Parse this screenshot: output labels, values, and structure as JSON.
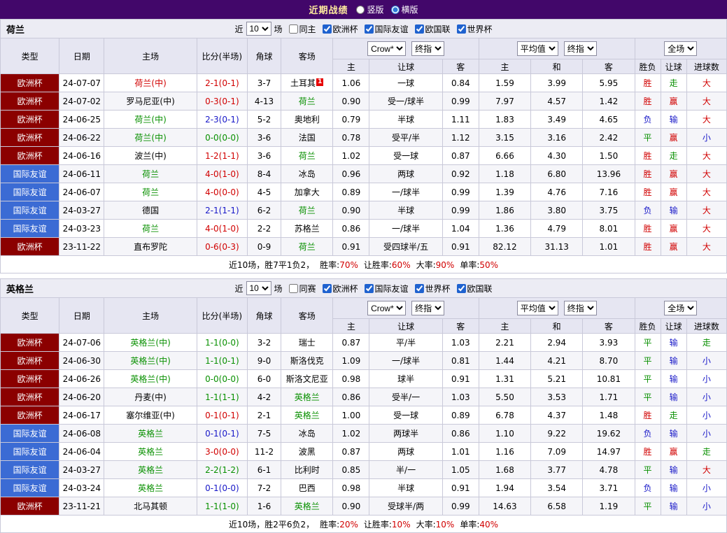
{
  "topbar": {
    "title": "近期战绩",
    "radios": [
      {
        "label": "竖版",
        "checked": false
      },
      {
        "label": "横版",
        "checked": true
      }
    ]
  },
  "table_headers": {
    "type": "类型",
    "date": "日期",
    "home": "主场",
    "score": "比分(半场)",
    "corners": "角球",
    "away": "客场",
    "asia": {
      "home": "主",
      "handicap": "让球",
      "away": "客"
    },
    "euro": {
      "home": "主",
      "draw": "和",
      "away": "客"
    },
    "result": {
      "outcome": "胜负",
      "handicap": "让球",
      "goals": "进球数"
    }
  },
  "colors": {
    "win_red": "#d10000",
    "draw_green": "#089000",
    "loss_blue": "#1818c8",
    "euro_cup_bg": "#8b0000",
    "friendly_bg": "#3b6bd4",
    "topbar_bg": "#42076a",
    "header_bg": "#e6e6f2"
  },
  "sections": [
    {
      "team": "荷兰",
      "filters": {
        "near": "近",
        "count": "10",
        "games": "场",
        "same": {
          "label": "同主",
          "checked": false
        },
        "leagues": [
          {
            "label": "欧洲杯",
            "checked": true
          },
          {
            "label": "国际友谊",
            "checked": true
          },
          {
            "label": "欧国联",
            "checked": true
          },
          {
            "label": "世界杯",
            "checked": true
          }
        ]
      },
      "selects": {
        "asia_provider": "Crow*",
        "asia_period": "终指",
        "euro_provider": "平均值",
        "euro_period": "终指",
        "scope": "全场"
      },
      "rows": [
        {
          "type": "欧洲杯",
          "type_style": "euro",
          "date": "24-07-07",
          "home": "荷兰(中)",
          "home_color": "red",
          "score": "2-1(0-1)",
          "score_color": "red",
          "corners": "3-7",
          "away": "土耳其",
          "away_color": "black",
          "away_badge": "1",
          "asia": [
            "1.06",
            "一球",
            "0.84"
          ],
          "euro": [
            "1.59",
            "3.99",
            "5.95"
          ],
          "results": [
            [
              "胜",
              "red"
            ],
            [
              "走",
              "green"
            ],
            [
              "大",
              "red"
            ]
          ]
        },
        {
          "type": "欧洲杯",
          "type_style": "euro",
          "date": "24-07-02",
          "home": "罗马尼亚(中)",
          "home_color": "black",
          "score": "0-3(0-1)",
          "score_color": "red",
          "corners": "4-13",
          "away": "荷兰",
          "away_color": "green",
          "asia": [
            "0.90",
            "受一/球半",
            "0.99"
          ],
          "euro": [
            "7.97",
            "4.57",
            "1.42"
          ],
          "results": [
            [
              "胜",
              "red"
            ],
            [
              "赢",
              "red"
            ],
            [
              "大",
              "red"
            ]
          ]
        },
        {
          "type": "欧洲杯",
          "type_style": "euro",
          "date": "24-06-25",
          "home": "荷兰(中)",
          "home_color": "green",
          "score": "2-3(0-1)",
          "score_color": "blue",
          "corners": "5-2",
          "away": "奥地利",
          "away_color": "black",
          "asia": [
            "0.79",
            "半球",
            "1.11"
          ],
          "euro": [
            "1.83",
            "3.49",
            "4.65"
          ],
          "results": [
            [
              "负",
              "blue"
            ],
            [
              "输",
              "blue"
            ],
            [
              "大",
              "red"
            ]
          ]
        },
        {
          "type": "欧洲杯",
          "type_style": "euro",
          "date": "24-06-22",
          "home": "荷兰(中)",
          "home_color": "green",
          "score": "0-0(0-0)",
          "score_color": "green",
          "corners": "3-6",
          "away": "法国",
          "away_color": "black",
          "asia": [
            "0.78",
            "受平/半",
            "1.12"
          ],
          "euro": [
            "3.15",
            "3.16",
            "2.42"
          ],
          "results": [
            [
              "平",
              "green"
            ],
            [
              "赢",
              "red"
            ],
            [
              "小",
              "blue"
            ]
          ]
        },
        {
          "type": "欧洲杯",
          "type_style": "euro",
          "date": "24-06-16",
          "home": "波兰(中)",
          "home_color": "black",
          "score": "1-2(1-1)",
          "score_color": "red",
          "corners": "3-6",
          "away": "荷兰",
          "away_color": "green",
          "asia": [
            "1.02",
            "受一球",
            "0.87"
          ],
          "euro": [
            "6.66",
            "4.30",
            "1.50"
          ],
          "results": [
            [
              "胜",
              "red"
            ],
            [
              "走",
              "green"
            ],
            [
              "大",
              "red"
            ]
          ]
        },
        {
          "type": "国际友谊",
          "type_style": "friendly",
          "date": "24-06-11",
          "home": "荷兰",
          "home_color": "green",
          "score": "4-0(1-0)",
          "score_color": "red",
          "corners": "8-4",
          "away": "冰岛",
          "away_color": "black",
          "asia": [
            "0.96",
            "两球",
            "0.92"
          ],
          "euro": [
            "1.18",
            "6.80",
            "13.96"
          ],
          "results": [
            [
              "胜",
              "red"
            ],
            [
              "赢",
              "red"
            ],
            [
              "大",
              "red"
            ]
          ]
        },
        {
          "type": "国际友谊",
          "type_style": "friendly",
          "date": "24-06-07",
          "home": "荷兰",
          "home_color": "green",
          "score": "4-0(0-0)",
          "score_color": "red",
          "corners": "4-5",
          "away": "加拿大",
          "away_color": "black",
          "asia": [
            "0.89",
            "一/球半",
            "0.99"
          ],
          "euro": [
            "1.39",
            "4.76",
            "7.16"
          ],
          "results": [
            [
              "胜",
              "red"
            ],
            [
              "赢",
              "red"
            ],
            [
              "大",
              "red"
            ]
          ]
        },
        {
          "type": "国际友谊",
          "type_style": "friendly",
          "date": "24-03-27",
          "home": "德国",
          "home_color": "black",
          "score": "2-1(1-1)",
          "score_color": "blue",
          "corners": "6-2",
          "away": "荷兰",
          "away_color": "green",
          "asia": [
            "0.90",
            "半球",
            "0.99"
          ],
          "euro": [
            "1.86",
            "3.80",
            "3.75"
          ],
          "results": [
            [
              "负",
              "blue"
            ],
            [
              "输",
              "blue"
            ],
            [
              "大",
              "red"
            ]
          ]
        },
        {
          "type": "国际友谊",
          "type_style": "friendly",
          "date": "24-03-23",
          "home": "荷兰",
          "home_color": "green",
          "score": "4-0(1-0)",
          "score_color": "red",
          "corners": "2-2",
          "away": "苏格兰",
          "away_color": "black",
          "asia": [
            "0.86",
            "一/球半",
            "1.04"
          ],
          "euro": [
            "1.36",
            "4.79",
            "8.01"
          ],
          "results": [
            [
              "胜",
              "red"
            ],
            [
              "赢",
              "red"
            ],
            [
              "大",
              "red"
            ]
          ]
        },
        {
          "type": "欧洲杯",
          "type_style": "euro",
          "date": "23-11-22",
          "home": "直布罗陀",
          "home_color": "black",
          "score": "0-6(0-3)",
          "score_color": "red",
          "corners": "0-9",
          "away": "荷兰",
          "away_color": "green",
          "asia": [
            "0.91",
            "受四球半/五",
            "0.91"
          ],
          "euro": [
            "82.12",
            "31.13",
            "1.01"
          ],
          "results": [
            [
              "胜",
              "red"
            ],
            [
              "赢",
              "red"
            ],
            [
              "大",
              "red"
            ]
          ]
        }
      ],
      "footer": {
        "prefix": "近10场，胜7平1负2，",
        "stats": [
          [
            "胜率:",
            "70%"
          ],
          [
            "让胜率:",
            "60%"
          ],
          [
            "大率:",
            "90%"
          ],
          [
            "单率:",
            "50%"
          ]
        ]
      }
    },
    {
      "team": "英格兰",
      "filters": {
        "near": "近",
        "count": "10",
        "games": "场",
        "same": {
          "label": "同赛",
          "checked": false
        },
        "leagues": [
          {
            "label": "欧洲杯",
            "checked": true
          },
          {
            "label": "国际友谊",
            "checked": true
          },
          {
            "label": "世界杯",
            "checked": true
          },
          {
            "label": "欧国联",
            "checked": true
          }
        ]
      },
      "selects": {
        "asia_provider": "Crow*",
        "asia_period": "终指",
        "euro_provider": "平均值",
        "euro_period": "终指",
        "scope": "全场"
      },
      "rows": [
        {
          "type": "欧洲杯",
          "type_style": "euro",
          "date": "24-07-06",
          "home": "英格兰(中)",
          "home_color": "green",
          "score": "1-1(0-0)",
          "score_color": "green",
          "corners": "3-2",
          "away": "瑞士",
          "away_color": "black",
          "asia": [
            "0.87",
            "平/半",
            "1.03"
          ],
          "euro": [
            "2.21",
            "2.94",
            "3.93"
          ],
          "results": [
            [
              "平",
              "green"
            ],
            [
              "输",
              "blue"
            ],
            [
              "走",
              "green"
            ]
          ]
        },
        {
          "type": "欧洲杯",
          "type_style": "euro",
          "date": "24-06-30",
          "home": "英格兰(中)",
          "home_color": "green",
          "score": "1-1(0-1)",
          "score_color": "green",
          "corners": "9-0",
          "away": "斯洛伐克",
          "away_color": "black",
          "asia": [
            "1.09",
            "一/球半",
            "0.81"
          ],
          "euro": [
            "1.44",
            "4.21",
            "8.70"
          ],
          "results": [
            [
              "平",
              "green"
            ],
            [
              "输",
              "blue"
            ],
            [
              "小",
              "blue"
            ]
          ]
        },
        {
          "type": "欧洲杯",
          "type_style": "euro",
          "date": "24-06-26",
          "home": "英格兰(中)",
          "home_color": "green",
          "score": "0-0(0-0)",
          "score_color": "green",
          "corners": "6-0",
          "away": "斯洛文尼亚",
          "away_color": "black",
          "asia": [
            "0.98",
            "球半",
            "0.91"
          ],
          "euro": [
            "1.31",
            "5.21",
            "10.81"
          ],
          "results": [
            [
              "平",
              "green"
            ],
            [
              "输",
              "blue"
            ],
            [
              "小",
              "blue"
            ]
          ]
        },
        {
          "type": "欧洲杯",
          "type_style": "euro",
          "date": "24-06-20",
          "home": "丹麦(中)",
          "home_color": "black",
          "score": "1-1(1-1)",
          "score_color": "green",
          "corners": "4-2",
          "away": "英格兰",
          "away_color": "green",
          "asia": [
            "0.86",
            "受半/一",
            "1.03"
          ],
          "euro": [
            "5.50",
            "3.53",
            "1.71"
          ],
          "results": [
            [
              "平",
              "green"
            ],
            [
              "输",
              "blue"
            ],
            [
              "小",
              "blue"
            ]
          ]
        },
        {
          "type": "欧洲杯",
          "type_style": "euro",
          "date": "24-06-17",
          "home": "塞尔维亚(中)",
          "home_color": "black",
          "score": "0-1(0-1)",
          "score_color": "red",
          "corners": "2-1",
          "away": "英格兰",
          "away_color": "green",
          "asia": [
            "1.00",
            "受一球",
            "0.89"
          ],
          "euro": [
            "6.78",
            "4.37",
            "1.48"
          ],
          "results": [
            [
              "胜",
              "red"
            ],
            [
              "走",
              "green"
            ],
            [
              "小",
              "blue"
            ]
          ]
        },
        {
          "type": "国际友谊",
          "type_style": "friendly",
          "date": "24-06-08",
          "home": "英格兰",
          "home_color": "green",
          "score": "0-1(0-1)",
          "score_color": "blue",
          "corners": "7-5",
          "away": "冰岛",
          "away_color": "black",
          "asia": [
            "1.02",
            "两球半",
            "0.86"
          ],
          "euro": [
            "1.10",
            "9.22",
            "19.62"
          ],
          "results": [
            [
              "负",
              "blue"
            ],
            [
              "输",
              "blue"
            ],
            [
              "小",
              "blue"
            ]
          ]
        },
        {
          "type": "国际友谊",
          "type_style": "friendly",
          "date": "24-06-04",
          "home": "英格兰",
          "home_color": "green",
          "score": "3-0(0-0)",
          "score_color": "red",
          "corners": "11-2",
          "away": "波黑",
          "away_color": "black",
          "asia": [
            "0.87",
            "两球",
            "1.01"
          ],
          "euro": [
            "1.16",
            "7.09",
            "14.97"
          ],
          "results": [
            [
              "胜",
              "red"
            ],
            [
              "赢",
              "red"
            ],
            [
              "走",
              "green"
            ]
          ]
        },
        {
          "type": "国际友谊",
          "type_style": "friendly",
          "date": "24-03-27",
          "home": "英格兰",
          "home_color": "green",
          "score": "2-2(1-2)",
          "score_color": "green",
          "corners": "6-1",
          "away": "比利时",
          "away_color": "black",
          "asia": [
            "0.85",
            "半/一",
            "1.05"
          ],
          "euro": [
            "1.68",
            "3.77",
            "4.78"
          ],
          "results": [
            [
              "平",
              "green"
            ],
            [
              "输",
              "blue"
            ],
            [
              "大",
              "red"
            ]
          ]
        },
        {
          "type": "国际友谊",
          "type_style": "friendly",
          "date": "24-03-24",
          "home": "英格兰",
          "home_color": "green",
          "score": "0-1(0-0)",
          "score_color": "blue",
          "corners": "7-2",
          "away": "巴西",
          "away_color": "black",
          "asia": [
            "0.98",
            "半球",
            "0.91"
          ],
          "euro": [
            "1.94",
            "3.54",
            "3.71"
          ],
          "results": [
            [
              "负",
              "blue"
            ],
            [
              "输",
              "blue"
            ],
            [
              "小",
              "blue"
            ]
          ]
        },
        {
          "type": "欧洲杯",
          "type_style": "euro",
          "date": "23-11-21",
          "home": "北马其顿",
          "home_color": "black",
          "score": "1-1(1-0)",
          "score_color": "green",
          "corners": "1-6",
          "away": "英格兰",
          "away_color": "green",
          "asia": [
            "0.90",
            "受球半/两",
            "0.99"
          ],
          "euro": [
            "14.63",
            "6.58",
            "1.19"
          ],
          "results": [
            [
              "平",
              "green"
            ],
            [
              "输",
              "blue"
            ],
            [
              "小",
              "blue"
            ]
          ]
        }
      ],
      "footer": {
        "prefix": "近10场，胜2平6负2，",
        "stats": [
          [
            "胜率:",
            "20%"
          ],
          [
            "让胜率:",
            "10%"
          ],
          [
            "大率:",
            "10%"
          ],
          [
            "单率:",
            "40%"
          ]
        ]
      }
    }
  ]
}
